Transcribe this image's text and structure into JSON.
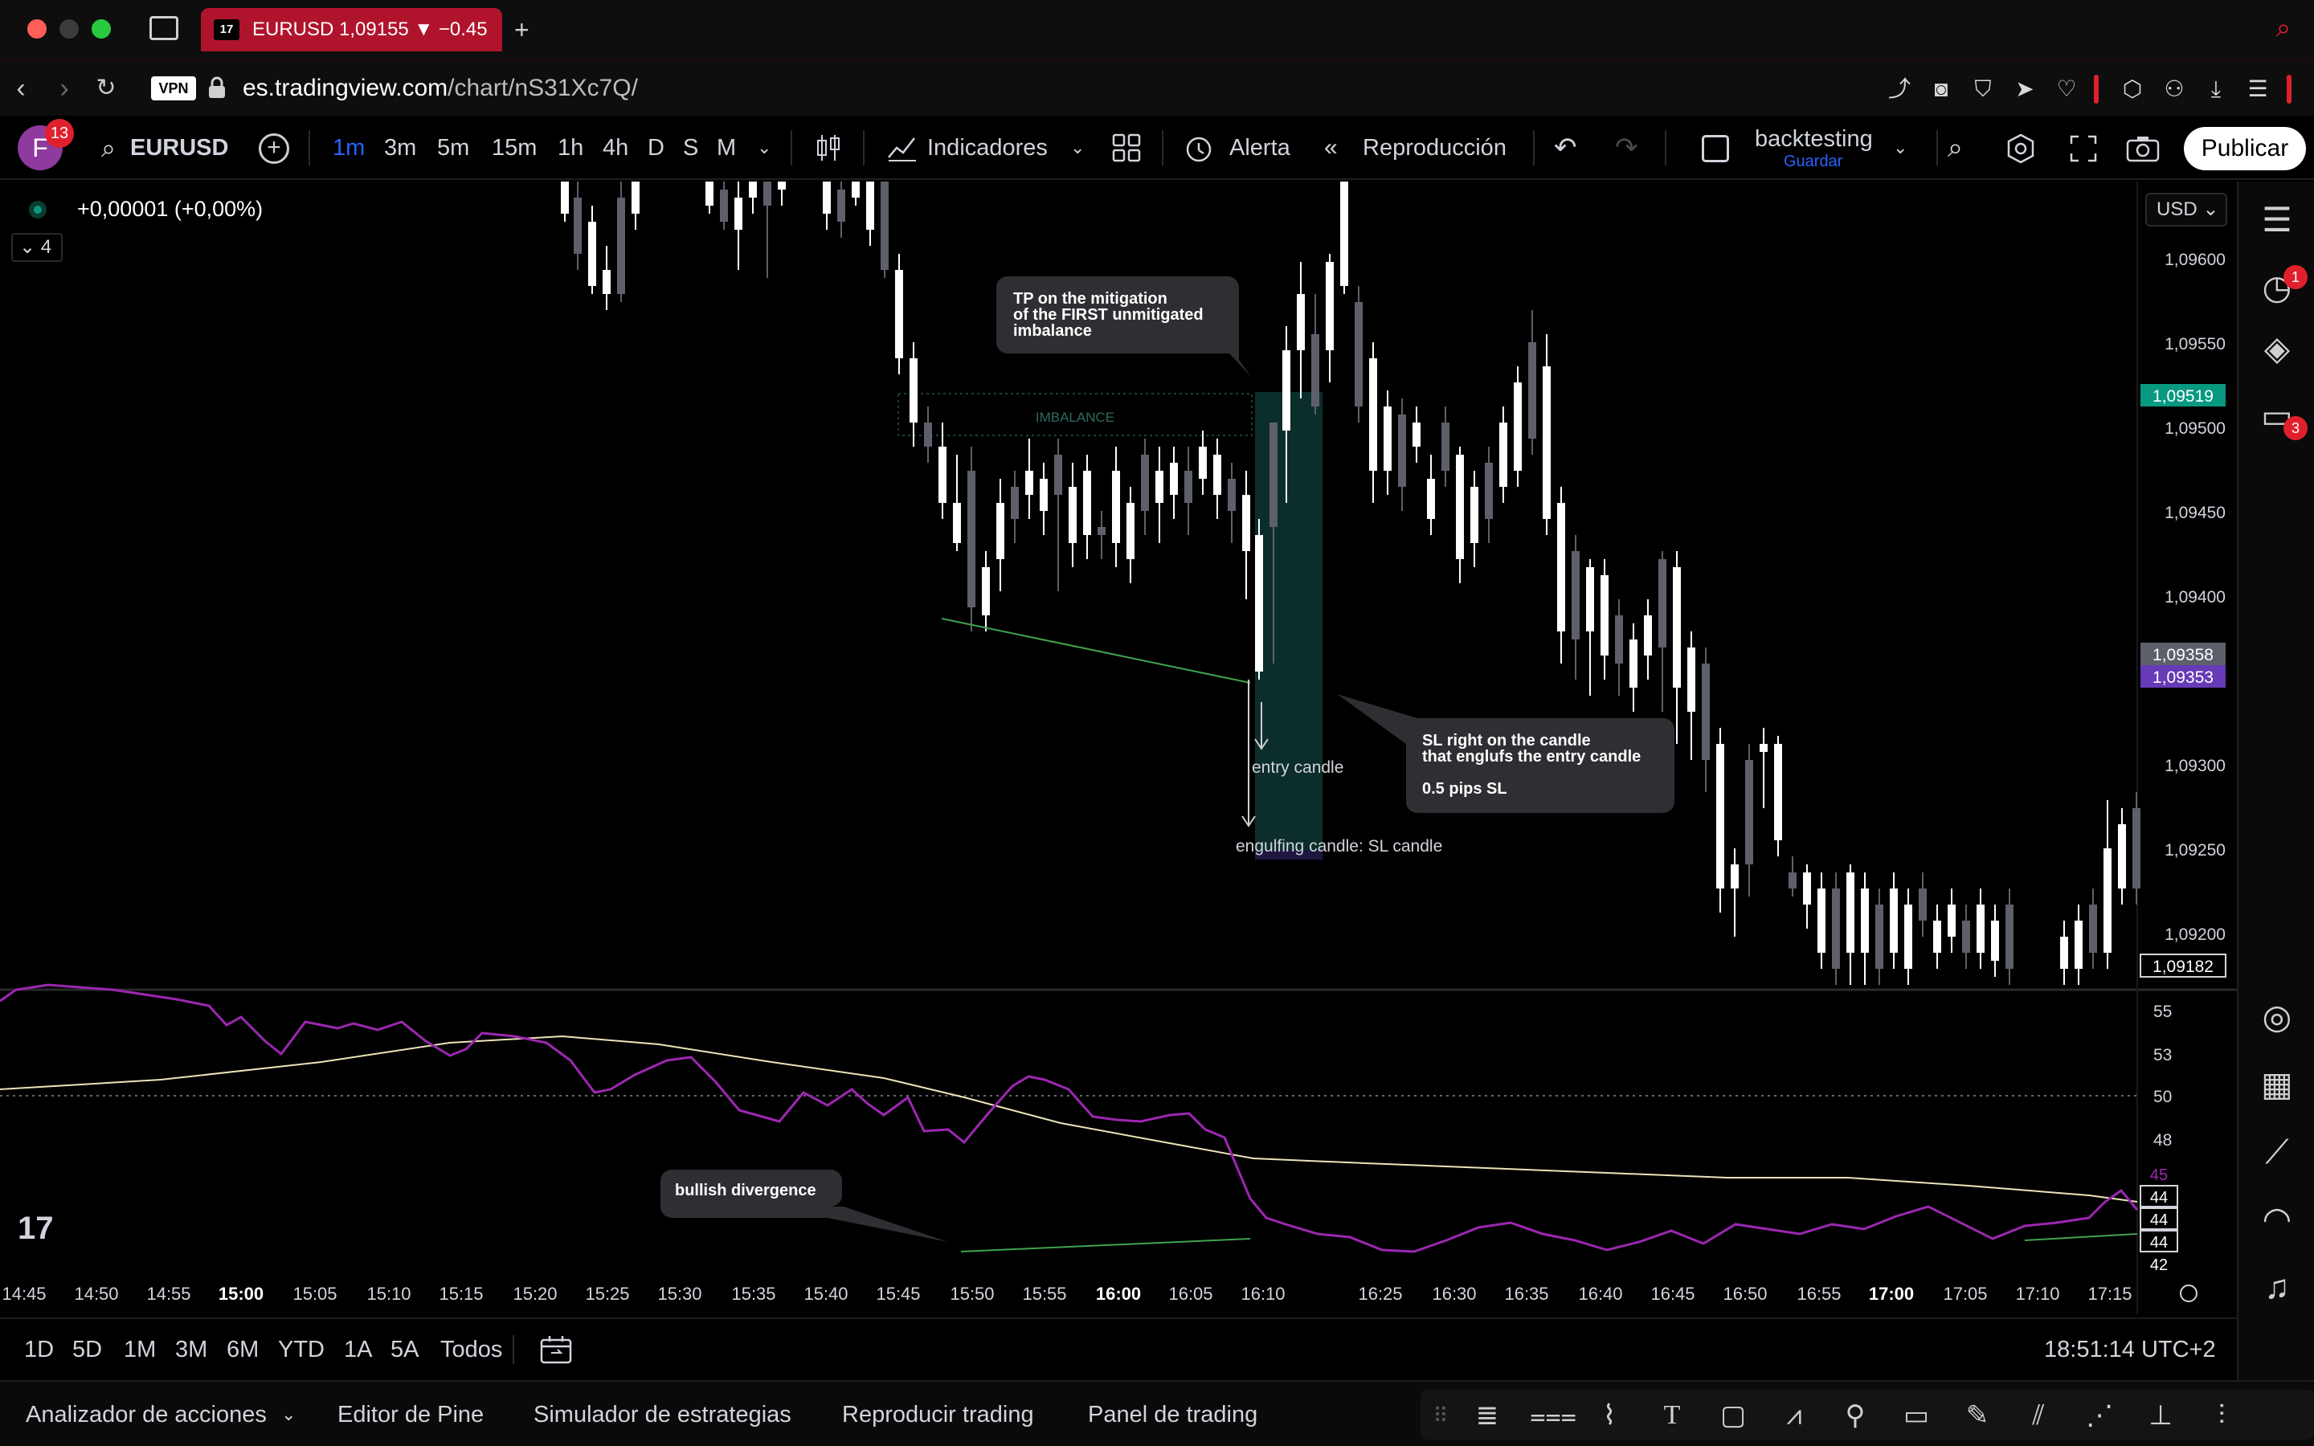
{
  "browser": {
    "tab_logo": "17",
    "tab_title": "EURUSD 1,09155 ▼ −0.45",
    "vpn_label": "VPN",
    "url_host": "es.tradingview.com",
    "url_path": "/chart/nS31Xc7Q/"
  },
  "toolbar": {
    "avatar_letter": "F",
    "avatar_badge": "13",
    "symbol": "EURUSD",
    "intervals": [
      "1m",
      "3m",
      "5m",
      "15m",
      "1h",
      "4h",
      "D",
      "S",
      "M"
    ],
    "active_interval": "1m",
    "indicators_label": "Indicadores",
    "alert_label": "Alerta",
    "replay_label": "Reproducción",
    "layout_name": "backtesting",
    "layout_sub": "Guardar",
    "publish_label": "Publicar",
    "accent": "#2962ff"
  },
  "chart": {
    "price_change": "+0,00001 (+0,00%)",
    "indicator_count": "4",
    "currency": "USD",
    "price_axis": [
      "1,09600",
      "1,09550",
      "1,09500",
      "1,09450",
      "1,09400",
      "1,09300",
      "1,09250",
      "1,09200"
    ],
    "price_tags": {
      "green": "1,09519",
      "gray": "1,09358",
      "purple": "1,09353",
      "current": "1,09182"
    },
    "rsi_axis": [
      "55",
      "53",
      "50",
      "48"
    ],
    "rsi_tags": [
      "45",
      "44",
      "44",
      "44",
      "42"
    ],
    "time_axis": [
      "14:45",
      "14:50",
      "14:55",
      "15:00",
      "15:05",
      "15:10",
      "15:15",
      "15:20",
      "15:25",
      "15:30",
      "15:35",
      "15:40",
      "15:45",
      "15:50",
      "15:55",
      "16:00",
      "16:05",
      "16:10",
      "16:25",
      "16:30",
      "16:35",
      "16:40",
      "16:45",
      "16:50",
      "16:55",
      "17:00",
      "17:05",
      "17:10",
      "17:15"
    ],
    "bold_times": [
      "15:00",
      "16:00",
      "17:00"
    ],
    "annotations": {
      "tp_line1": "TP on the mitigation",
      "tp_line2": "of the FIRST unmitigated",
      "tp_line3": "imbalance",
      "imbalance": "IMBALANCE",
      "entry": "entry candle",
      "engulf": "engulfing candle: SL candle",
      "sl_line1": "SL right on the candle",
      "sl_line2": "that englufs the entry candle",
      "sl_line3": "0.5 pips SL",
      "divergence": "bullish divergence"
    },
    "colors": {
      "up": "#ffffff",
      "down": "#5d606b",
      "rsi": "#9c27b0",
      "rsi_ma": "#ece4b7",
      "imbalance": "#0b2e2a",
      "trend": "#3fa34d"
    }
  },
  "ranges": {
    "items": [
      "1D",
      "5D",
      "1M",
      "3M",
      "6M",
      "YTD",
      "1A",
      "5A",
      "Todos"
    ],
    "clock": "18:51:14 UTC+2"
  },
  "bottom_tabs": [
    "Analizador de acciones",
    "Editor de Pine",
    "Simulador de estrategias",
    "Reproducir trading",
    "Panel de trading"
  ],
  "sidebar_badges": {
    "alerts": "1",
    "chats": "3"
  }
}
